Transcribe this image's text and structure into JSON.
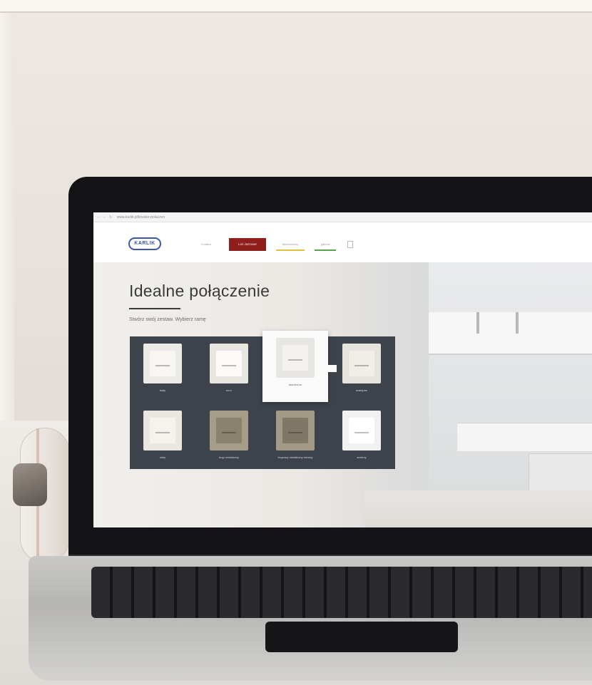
{
  "browser": {
    "url": "www.karlik.pl/kreator-polaczen",
    "nav_glyphs": [
      "‹",
      "›",
      "↻"
    ]
  },
  "site": {
    "logo_text": "KARLIK",
    "nav": [
      {
        "label": "Creative",
        "style": "plain"
      },
      {
        "label": "Lini Jazzowe",
        "style": "active"
      },
      {
        "label": "Mechanizmy",
        "style": "u-yellow"
      },
      {
        "label": "galeria",
        "style": "u-green"
      }
    ]
  },
  "hero": {
    "title": "Idealne połączenie",
    "subtitle": "Stwórz swój zestaw. Wybierz ramę"
  },
  "picker": {
    "tiles": [
      {
        "label": "biały",
        "frame": "#eceae6",
        "inner": "#f7f6f3",
        "selected": false
      },
      {
        "label": "ecru",
        "frame": "#e8e6e1",
        "inner": "#fbfaf7",
        "selected": false
      },
      {
        "label": "aluminium",
        "frame": "#e7e6e2",
        "inner": "#f3f2ee",
        "selected": true
      },
      {
        "label": "szampan",
        "frame": "#e6e3dc",
        "inner": "#f1eee7",
        "selected": false
      },
      {
        "label": "złoty",
        "frame": "#eae7e1",
        "inner": "#f5f3ee",
        "selected": false
      },
      {
        "label": "brąz metaliczny",
        "frame": "#a59c89",
        "inner": "#8a826f",
        "selected": false
      },
      {
        "label": "brązowy metaliczny ciemny",
        "frame": "#a39b86",
        "inner": "#7f7866",
        "selected": false
      },
      {
        "label": "srebrny",
        "frame": "#f1f1f1",
        "inner": "#ffffff",
        "selected": false
      }
    ]
  }
}
